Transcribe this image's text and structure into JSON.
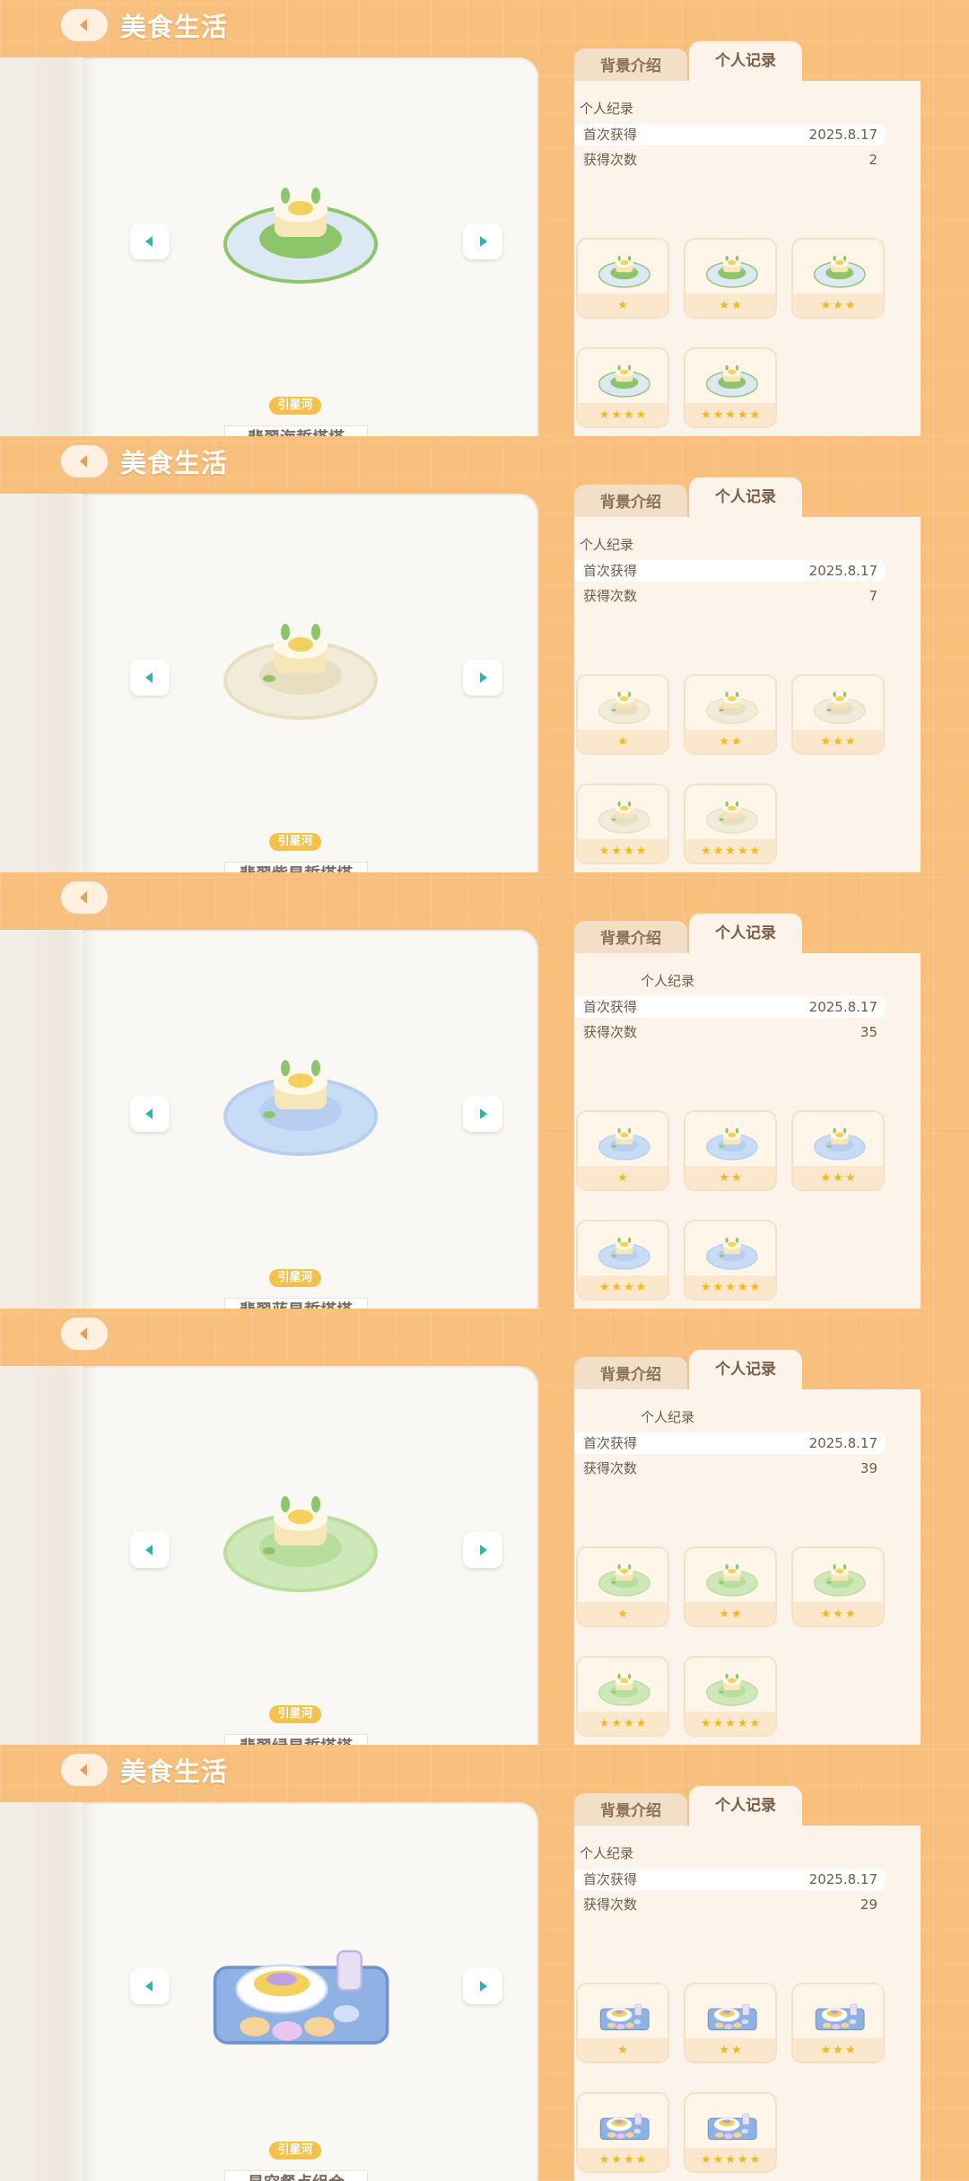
{
  "screens": [
    {
      "header_title": "美食生活",
      "food_name": "翡翠海蜇塔塔",
      "tag": "引星河",
      "tabs": {
        "background": "背景介绍",
        "record": "个人记录"
      },
      "section_title": "个人纪录",
      "first_obtained_label": "首次获得",
      "first_obtained_value": "2025.8.17",
      "times_label": "获得次数",
      "times_value": "2",
      "plate_color": "#dce9f5",
      "rim_color": "#8cc56a",
      "accent": "#f3d15c"
    },
    {
      "header_title": "美食生活",
      "food_name": "翡翠紫星蜇塔塔",
      "tag": "引星河",
      "tabs": {
        "background": "背景介绍",
        "record": "个人记录"
      },
      "section_title": "个人纪录",
      "first_obtained_label": "首次获得",
      "first_obtained_value": "2025.8.17",
      "times_label": "获得次数",
      "times_value": "7",
      "plate_color": "#f1ecd9",
      "rim_color": "#e9dfc0",
      "accent": "#f3d15c"
    },
    {
      "header_title": "",
      "food_name": "翡翠蓝星蜇塔塔",
      "tag": "引星河",
      "tabs": {
        "background": "背景介绍",
        "record": "个人记录"
      },
      "section_title": "个人纪录",
      "first_obtained_label": "首次获得",
      "first_obtained_value": "2025.8.17",
      "times_label": "获得次数",
      "times_value": "35",
      "plate_color": "#c9dcf6",
      "rim_color": "#b7cef0",
      "accent": "#f3d15c"
    },
    {
      "header_title": "",
      "food_name": "翡翠绿星蜇塔塔",
      "tag": "引星河",
      "tabs": {
        "background": "背景介绍",
        "record": "个人记录"
      },
      "section_title": "个人纪录",
      "first_obtained_label": "首次获得",
      "first_obtained_value": "2025.8.17",
      "times_label": "获得次数",
      "times_value": "39",
      "plate_color": "#cfe8b9",
      "rim_color": "#b9dd9c",
      "accent": "#f3d15c"
    },
    {
      "header_title": "美食生活",
      "food_name": "星空餐点组合",
      "tag": "引星河",
      "tabs": {
        "background": "背景介绍",
        "record": "个人记录"
      },
      "section_title": "个人纪录",
      "first_obtained_label": "首次获得",
      "first_obtained_value": "2025.8.17",
      "times_label": "获得次数",
      "times_value": "29",
      "plate_color": "#8fb1e3",
      "rim_color": "#a9c3ec",
      "accent": "#f3d15c"
    }
  ],
  "thumb_star_counts": [
    1,
    2,
    3,
    4,
    5
  ],
  "main_star_count": 5,
  "icons": {
    "back": "back-arrow-icon",
    "prev": "left-arrow-icon",
    "next": "right-arrow-icon",
    "star": "star-icon"
  }
}
